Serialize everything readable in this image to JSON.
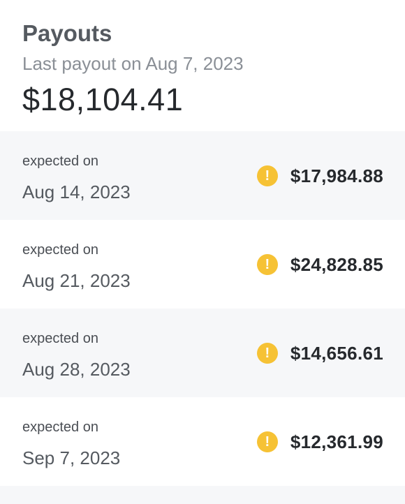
{
  "header": {
    "title": "Payouts",
    "subtitle": "Last payout on Aug 7, 2023",
    "total": "$18,104.41"
  },
  "payouts": [
    {
      "caption": "expected on",
      "date": "Aug 14, 2023",
      "amount": "$17,984.88",
      "status_icon": "warning-icon"
    },
    {
      "caption": "expected on",
      "date": "Aug 21, 2023",
      "amount": "$24,828.85",
      "status_icon": "warning-icon"
    },
    {
      "caption": "expected on",
      "date": "Aug 28, 2023",
      "amount": "$14,656.61",
      "status_icon": "warning-icon"
    },
    {
      "caption": "expected on",
      "date": "Sep 7, 2023",
      "amount": "$12,361.99",
      "status_icon": "warning-icon"
    }
  ],
  "colors": {
    "warning": "#f6c235",
    "row_alt_bg": "#f6f7f9"
  }
}
